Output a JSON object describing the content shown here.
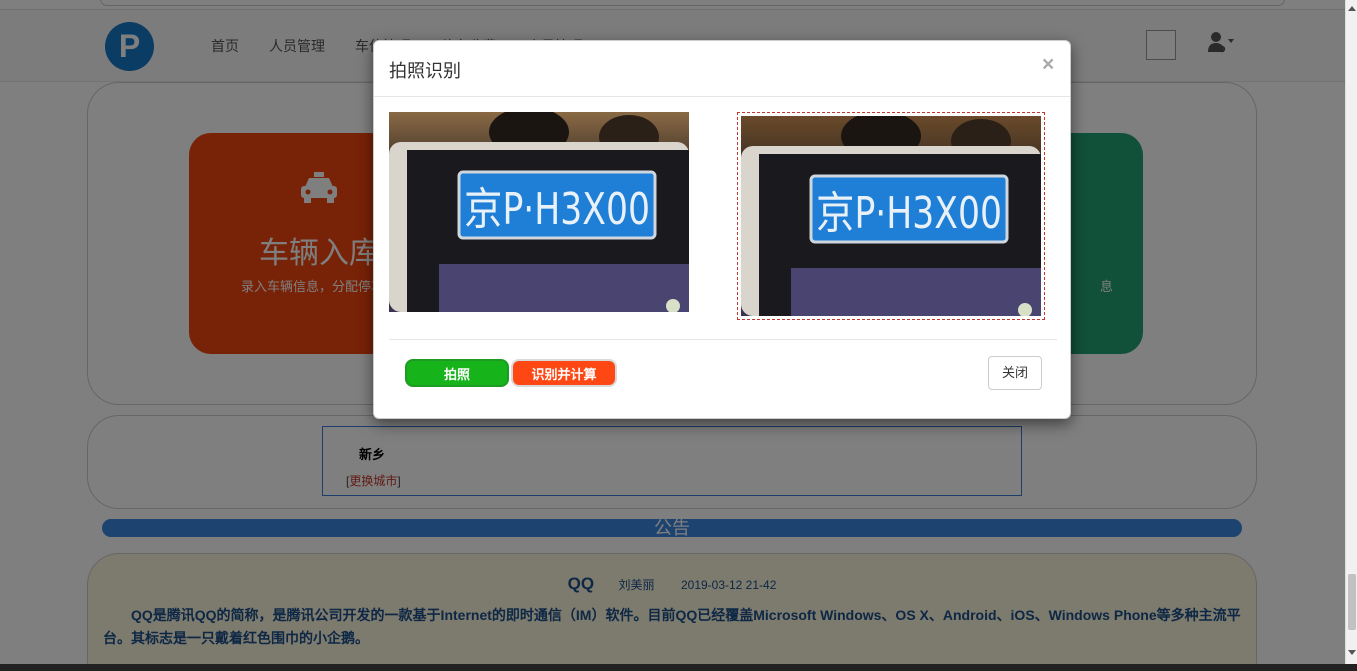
{
  "nav": {
    "logo_letter": "P",
    "links": [
      "首页",
      "人员管理",
      "车位管理",
      "停车收费",
      "会员管理"
    ]
  },
  "tiles": {
    "left": {
      "title": "车辆入库",
      "subtitle": "录入车辆信息，分配停车位"
    },
    "right": {
      "subtitle": "息"
    }
  },
  "city": {
    "name": "新乡",
    "change_prefix": "[",
    "change_link": "更换城市",
    "change_suffix": "]"
  },
  "notice": {
    "bar_label": "公告",
    "title": "QQ",
    "author": "刘美丽",
    "date": "2019-03-12 21-42",
    "body": "QQ是腾讯QQ的简称，是腾讯公司开发的一款基于Internet的即时通信（IM）软件。目前QQ已经覆盖Microsoft Windows、OS X、Android、iOS、Windows Phone等多种主流平台。其标志是一只戴着红色围巾的小企鹅。"
  },
  "modal": {
    "title": "拍照识别",
    "close_x": "×",
    "plate_text": "京P·H3X00",
    "buttons": {
      "photo": "拍照",
      "recognize": "识别并计算",
      "close": "关闭"
    }
  },
  "colors": {
    "photo_button": "#16b31a",
    "recognize_button": "#ff4713",
    "tile_left": "#f0440e",
    "tile_right": "#23a173",
    "plate_blue": "#1f7fd6"
  }
}
